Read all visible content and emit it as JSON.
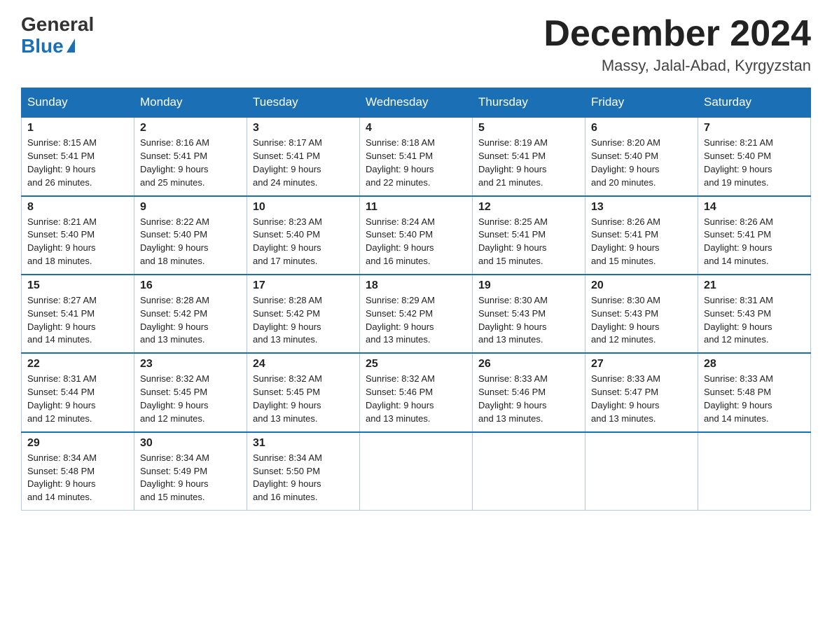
{
  "header": {
    "logo_general": "General",
    "logo_blue": "Blue",
    "title": "December 2024",
    "subtitle": "Massy, Jalal-Abad, Kyrgyzstan"
  },
  "days_of_week": [
    "Sunday",
    "Monday",
    "Tuesday",
    "Wednesday",
    "Thursday",
    "Friday",
    "Saturday"
  ],
  "weeks": [
    [
      {
        "day": "1",
        "sunrise": "8:15 AM",
        "sunset": "5:41 PM",
        "daylight": "9 hours and 26 minutes."
      },
      {
        "day": "2",
        "sunrise": "8:16 AM",
        "sunset": "5:41 PM",
        "daylight": "9 hours and 25 minutes."
      },
      {
        "day": "3",
        "sunrise": "8:17 AM",
        "sunset": "5:41 PM",
        "daylight": "9 hours and 24 minutes."
      },
      {
        "day": "4",
        "sunrise": "8:18 AM",
        "sunset": "5:41 PM",
        "daylight": "9 hours and 22 minutes."
      },
      {
        "day": "5",
        "sunrise": "8:19 AM",
        "sunset": "5:41 PM",
        "daylight": "9 hours and 21 minutes."
      },
      {
        "day": "6",
        "sunrise": "8:20 AM",
        "sunset": "5:40 PM",
        "daylight": "9 hours and 20 minutes."
      },
      {
        "day": "7",
        "sunrise": "8:21 AM",
        "sunset": "5:40 PM",
        "daylight": "9 hours and 19 minutes."
      }
    ],
    [
      {
        "day": "8",
        "sunrise": "8:21 AM",
        "sunset": "5:40 PM",
        "daylight": "9 hours and 18 minutes."
      },
      {
        "day": "9",
        "sunrise": "8:22 AM",
        "sunset": "5:40 PM",
        "daylight": "9 hours and 18 minutes."
      },
      {
        "day": "10",
        "sunrise": "8:23 AM",
        "sunset": "5:40 PM",
        "daylight": "9 hours and 17 minutes."
      },
      {
        "day": "11",
        "sunrise": "8:24 AM",
        "sunset": "5:40 PM",
        "daylight": "9 hours and 16 minutes."
      },
      {
        "day": "12",
        "sunrise": "8:25 AM",
        "sunset": "5:41 PM",
        "daylight": "9 hours and 15 minutes."
      },
      {
        "day": "13",
        "sunrise": "8:26 AM",
        "sunset": "5:41 PM",
        "daylight": "9 hours and 15 minutes."
      },
      {
        "day": "14",
        "sunrise": "8:26 AM",
        "sunset": "5:41 PM",
        "daylight": "9 hours and 14 minutes."
      }
    ],
    [
      {
        "day": "15",
        "sunrise": "8:27 AM",
        "sunset": "5:41 PM",
        "daylight": "9 hours and 14 minutes."
      },
      {
        "day": "16",
        "sunrise": "8:28 AM",
        "sunset": "5:42 PM",
        "daylight": "9 hours and 13 minutes."
      },
      {
        "day": "17",
        "sunrise": "8:28 AM",
        "sunset": "5:42 PM",
        "daylight": "9 hours and 13 minutes."
      },
      {
        "day": "18",
        "sunrise": "8:29 AM",
        "sunset": "5:42 PM",
        "daylight": "9 hours and 13 minutes."
      },
      {
        "day": "19",
        "sunrise": "8:30 AM",
        "sunset": "5:43 PM",
        "daylight": "9 hours and 13 minutes."
      },
      {
        "day": "20",
        "sunrise": "8:30 AM",
        "sunset": "5:43 PM",
        "daylight": "9 hours and 12 minutes."
      },
      {
        "day": "21",
        "sunrise": "8:31 AM",
        "sunset": "5:43 PM",
        "daylight": "9 hours and 12 minutes."
      }
    ],
    [
      {
        "day": "22",
        "sunrise": "8:31 AM",
        "sunset": "5:44 PM",
        "daylight": "9 hours and 12 minutes."
      },
      {
        "day": "23",
        "sunrise": "8:32 AM",
        "sunset": "5:45 PM",
        "daylight": "9 hours and 12 minutes."
      },
      {
        "day": "24",
        "sunrise": "8:32 AM",
        "sunset": "5:45 PM",
        "daylight": "9 hours and 13 minutes."
      },
      {
        "day": "25",
        "sunrise": "8:32 AM",
        "sunset": "5:46 PM",
        "daylight": "9 hours and 13 minutes."
      },
      {
        "day": "26",
        "sunrise": "8:33 AM",
        "sunset": "5:46 PM",
        "daylight": "9 hours and 13 minutes."
      },
      {
        "day": "27",
        "sunrise": "8:33 AM",
        "sunset": "5:47 PM",
        "daylight": "9 hours and 13 minutes."
      },
      {
        "day": "28",
        "sunrise": "8:33 AM",
        "sunset": "5:48 PM",
        "daylight": "9 hours and 14 minutes."
      }
    ],
    [
      {
        "day": "29",
        "sunrise": "8:34 AM",
        "sunset": "5:48 PM",
        "daylight": "9 hours and 14 minutes."
      },
      {
        "day": "30",
        "sunrise": "8:34 AM",
        "sunset": "5:49 PM",
        "daylight": "9 hours and 15 minutes."
      },
      {
        "day": "31",
        "sunrise": "8:34 AM",
        "sunset": "5:50 PM",
        "daylight": "9 hours and 16 minutes."
      },
      null,
      null,
      null,
      null
    ]
  ]
}
